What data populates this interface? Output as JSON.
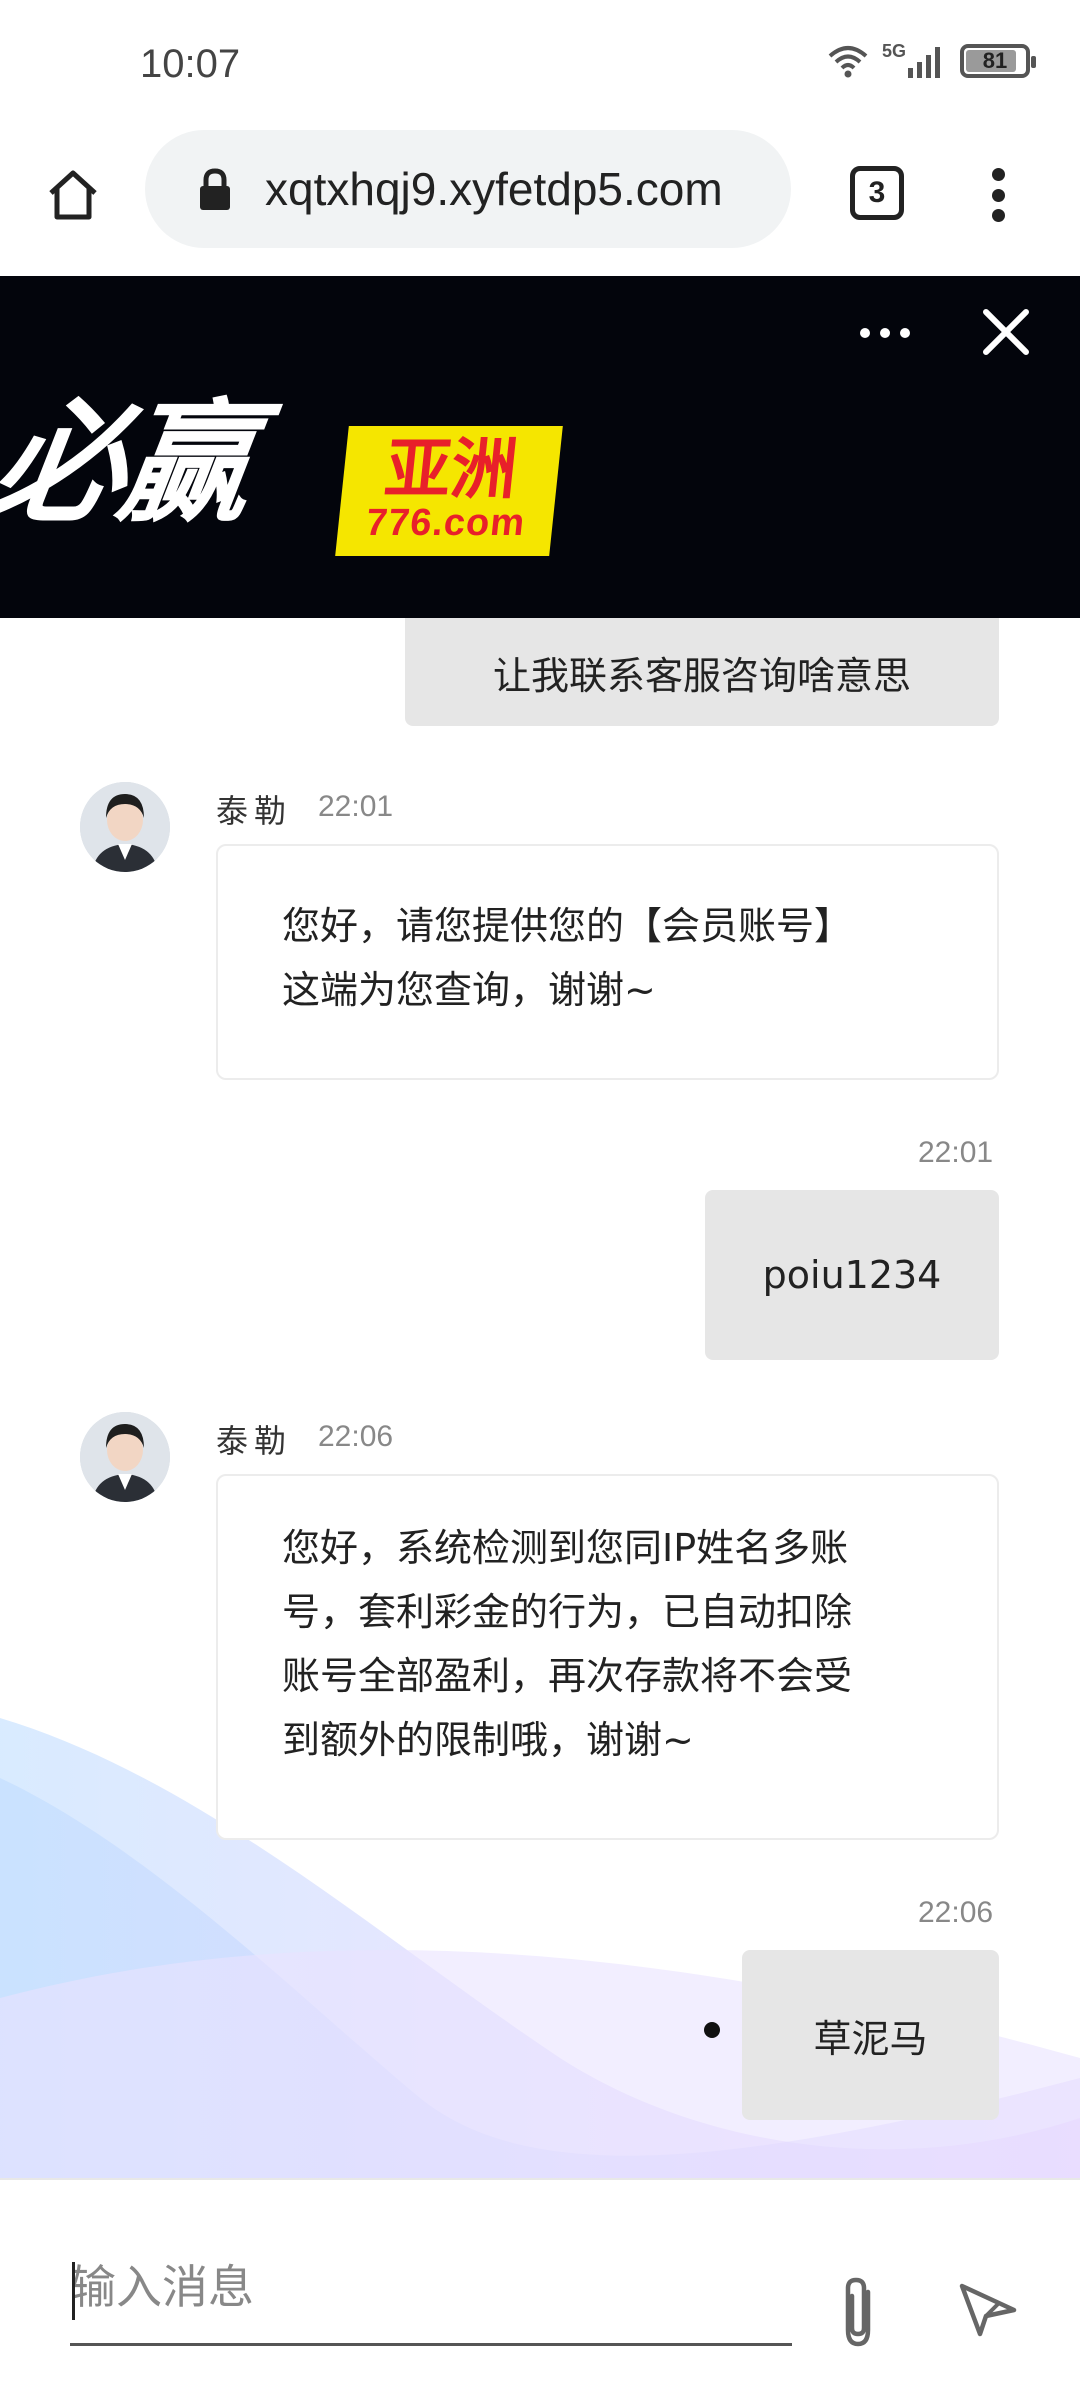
{
  "status_bar": {
    "time": "10:07",
    "network": "5G",
    "battery": "81",
    "battery_level": 0.81
  },
  "browser": {
    "url": "xqtxhqj9.xyfetdp5.com",
    "tab_count": "3"
  },
  "banner": {
    "logo_main": "必赢",
    "logo_asia": "亚洲",
    "logo_domain": "776.com"
  },
  "messages": [
    {
      "side": "right",
      "text": "让我联系客服咨询啥意思"
    },
    {
      "side": "left",
      "agent": "泰勒",
      "time": "22:01",
      "lines": [
        "您好，请您提供您的【会员账号】",
        "这端为您查询，谢谢~"
      ]
    },
    {
      "side": "right",
      "time": "22:01",
      "text": "poiu1234"
    },
    {
      "side": "left",
      "agent": "泰勒",
      "time": "22:06",
      "lines": [
        "您好，系统检测到您同IP姓名多账",
        "号，套利彩金的行为，已自动扣除",
        "账号全部盈利，再次存款将不会受",
        "到额外的限制哦，谢谢~"
      ]
    },
    {
      "side": "right",
      "time": "22:06",
      "text": "草泥马"
    }
  ],
  "input": {
    "placeholder": "输入消息",
    "value": ""
  },
  "icons": {
    "home": "home-icon",
    "lock": "lock-icon",
    "menu": "more-vert-icon",
    "banner_more": "more-horiz-icon",
    "banner_close": "close-icon",
    "attach": "paperclip-icon",
    "send": "send-icon"
  }
}
